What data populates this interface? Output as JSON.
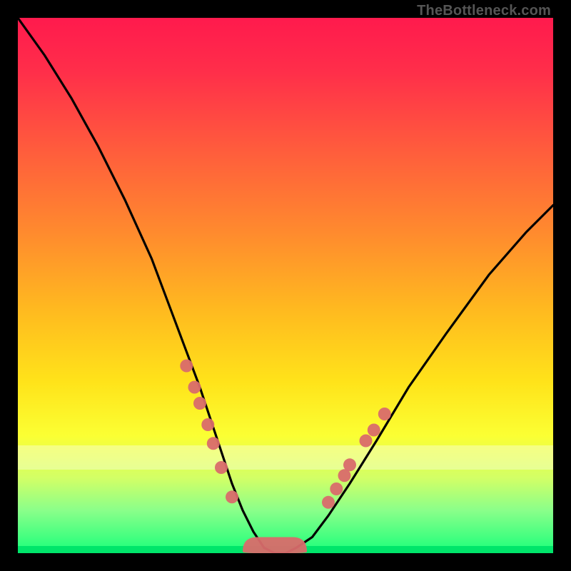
{
  "watermark": "TheBottleneck.com",
  "chart_data": {
    "type": "line",
    "title": "",
    "xlabel": "",
    "ylabel": "",
    "xlim": [
      0,
      100
    ],
    "ylim": [
      0,
      100
    ],
    "grid": false,
    "legend": false,
    "background": "vertical-rainbow-gradient",
    "annotations": {
      "highlight_band_y": [
        80,
        84.5
      ],
      "baseline_strip_y": [
        0,
        1.3
      ]
    },
    "series": [
      {
        "name": "bottleneck-curve",
        "kind": "line",
        "x": [
          0,
          5,
          10,
          15,
          20,
          25,
          28,
          31,
          34,
          36,
          38,
          40,
          42,
          44,
          46,
          48,
          50,
          52,
          55,
          58,
          62,
          67,
          73,
          80,
          88,
          95,
          100
        ],
        "y": [
          100,
          93,
          85,
          76,
          66,
          55,
          47,
          39,
          31,
          25,
          19,
          13,
          8,
          4,
          1,
          0,
          0,
          1,
          3,
          7,
          13,
          21,
          31,
          41,
          52,
          60,
          65
        ]
      },
      {
        "name": "curve-markers-left",
        "kind": "scatter",
        "x": [
          31.5,
          33.0,
          34.0,
          35.5,
          36.5,
          38.0,
          40.0
        ],
        "y": [
          35.0,
          31.0,
          28.0,
          24.0,
          20.5,
          16.0,
          10.5
        ]
      },
      {
        "name": "curve-markers-right",
        "kind": "scatter",
        "x": [
          58.0,
          59.5,
          61.0,
          62.0,
          65.0,
          66.5,
          68.5
        ],
        "y": [
          9.5,
          12.0,
          14.5,
          16.5,
          21.0,
          23.0,
          26.0
        ]
      },
      {
        "name": "trough-blob",
        "kind": "area-marker",
        "x": [
          42,
          54
        ],
        "y": [
          0,
          3
        ]
      }
    ]
  }
}
